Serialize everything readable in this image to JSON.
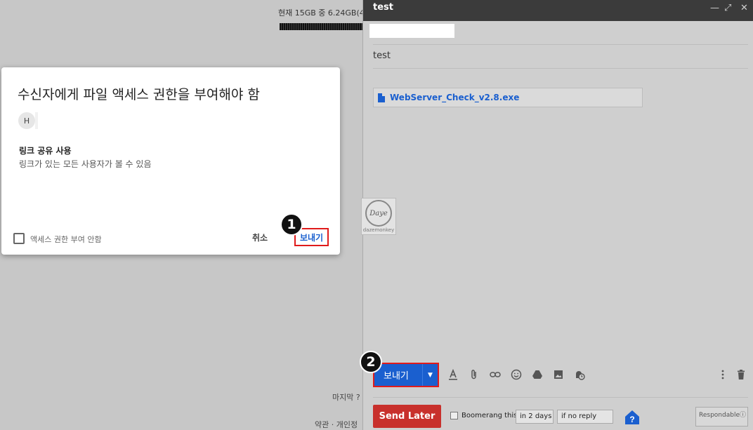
{
  "background": {
    "storage_text": "현재 15GB 중 6.24GB(4",
    "last_activity": "마지막 ?",
    "terms": "약관 · 개인정"
  },
  "dialog": {
    "title": "수신자에게 파일 액세스 권한을 부여해야 함",
    "avatar_initial": "H",
    "option_title": "링크 공유 사용",
    "option_desc": "링크가 있는 모든 사용자가 볼 수 있음",
    "no_access_label": "액세스 권한 부여 안함",
    "cancel_label": "취소",
    "send_label": "보내기"
  },
  "markers": {
    "one": "1",
    "two": "2"
  },
  "compose": {
    "title": "test",
    "subject": "test",
    "attachment_name": "WebServer_Check_v2.8.exe",
    "send_label": "보내기",
    "send_later_label": "Send Later",
    "boomerang_label": "Boomerang this",
    "boomerang_when": "in 2 days",
    "boomerang_condition": "if no reply",
    "help_label": "?",
    "responsable_label": "Respondable",
    "icons": [
      "minimize-icon",
      "expand-icon",
      "close-icon",
      "text-format-icon",
      "attach-icon",
      "link-icon",
      "emoji-icon",
      "drive-icon",
      "photo-icon",
      "schedule-icon",
      "more-icon",
      "trash-icon"
    ]
  },
  "watermark": {
    "mark": "Daye",
    "caption": "dazemonkey"
  },
  "colors": {
    "accent": "#1a5fcf",
    "highlight": "#e01b1b",
    "send_later": "#c8302c"
  }
}
